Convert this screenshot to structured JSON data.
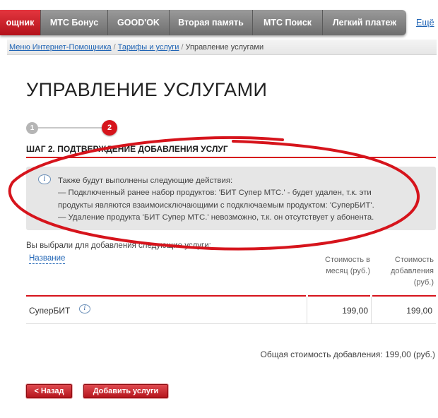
{
  "topnav": {
    "tabs": [
      "ощник",
      "МТС Бонус",
      "GOOD'OK",
      "Вторая память",
      "МТС Поиск",
      "Легкий платеж"
    ],
    "all_link": "Ещё"
  },
  "breadcrumb": {
    "items": [
      "Меню Интернет-Помощника",
      "Тарифы и услуги",
      "Управление услугами"
    ],
    "separator": "/"
  },
  "page_title": "УПРАВЛЕНИЕ УСЛУГАМИ",
  "steps": {
    "first": "1",
    "second": "2"
  },
  "step_heading": "ШАГ 2. ПОДТВЕРЖДЕНИЕ ДОБАВЛЕНИЯ УСЛУГ",
  "info": {
    "icon": "info-icon",
    "lines": [
      "Также будут выполнены следующие действия:",
      "— Подключенный ранее набор продуктов: 'БИТ Супер МТС.' - будет удален, т.к. эти",
      "продукты являются взаимоисключающими с подключаемым продуктом: 'СуперБИТ'.",
      "— Удаление продукта 'БИТ Супер МТС.' невозможно, т.к. он отсутствует у абонента."
    ]
  },
  "chosen_text": "Вы выбрали для добавления следующие услуги:",
  "table": {
    "headers": {
      "name": "Название",
      "month": [
        "Стоимость в",
        "месяц (руб.)"
      ],
      "add": [
        "Стоимость",
        "добавления",
        "(руб.)"
      ]
    },
    "rows": [
      {
        "name": "СуперБИТ",
        "month": "199,00",
        "add": "199,00"
      }
    ]
  },
  "total": "Общая стоимость добавления: 199,00 (руб.)",
  "buttons": {
    "back": "< Назад",
    "add": "Добавить услуги"
  },
  "colors": {
    "accent_red": "#d6141c",
    "link_blue": "#1f64b5",
    "nav_gray": "#7d7d7d"
  }
}
